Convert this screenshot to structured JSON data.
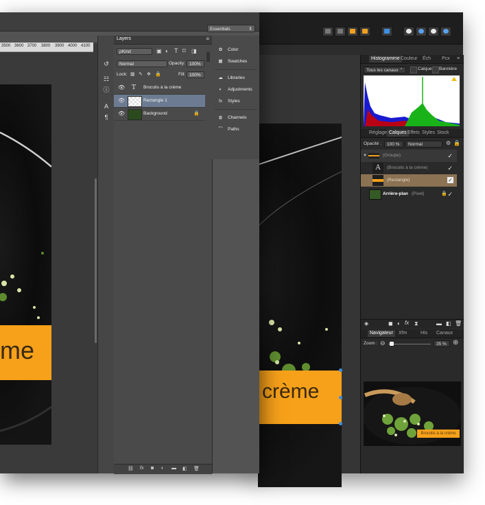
{
  "colors": {
    "accent": "#f7a11a",
    "ps_selected_row": "#6c7b91",
    "aff_selected_row": "#8a7253"
  },
  "photoshop": {
    "workspace_label": "Essentials",
    "ruler_ticks": [
      "3500",
      "3600",
      "3700",
      "3800",
      "3900",
      "4000",
      "4100"
    ],
    "photo_text": "me",
    "tool_icons": [
      "history-icon",
      "properties-icon",
      "info-icon",
      "character-icon",
      "paragraph-icon"
    ],
    "layers_panel": {
      "title": "Layers",
      "filter_label": "ρKind",
      "blend_mode": "Normal",
      "opacity_label": "Opacity:",
      "opacity_value": "100%",
      "lock_label": "Lock:",
      "fill_label": "Fill:",
      "fill_value": "100%",
      "layers": [
        {
          "name": "Brocolis à la crème",
          "kind": "text"
        },
        {
          "name": "Rectangle 1",
          "kind": "shape"
        },
        {
          "name": "Background",
          "kind": "image"
        }
      ]
    },
    "right_panels": [
      {
        "label": "Color",
        "icon": "color-icon"
      },
      {
        "label": "Swatches",
        "icon": "swatches-icon"
      },
      {
        "label": "Libraries",
        "icon": "libraries-icon"
      },
      {
        "label": "Adjustments",
        "icon": "adjustments-icon"
      },
      {
        "label": "Styles",
        "icon": "styles-icon"
      },
      {
        "label": "Channels",
        "icon": "channels-icon"
      },
      {
        "label": "Paths",
        "icon": "paths-icon"
      }
    ]
  },
  "affinity": {
    "histogram_tabs": [
      "Histogramme",
      "Couleur",
      "Éch",
      "Pcx"
    ],
    "channel_select": "Tous les canaux",
    "calque_label": "Calque",
    "banniere_label": "Bannière",
    "layer_tabs": [
      "Réglage",
      "Calques",
      "Effets",
      "Styles",
      "Stock"
    ],
    "opacity_label": "Opacité :",
    "opacity_value": "100 %",
    "blend_mode": "Normal",
    "layers": [
      {
        "name": "(Groupe)"
      },
      {
        "name": "(Brocolis à la crème)"
      },
      {
        "name": "(Rectangle)"
      },
      {
        "name": "Arrière-plan",
        "suffix": "(Pixel)"
      }
    ],
    "nav_tabs": [
      "Navigateur",
      "Xfm",
      "His",
      "Canaux"
    ],
    "zoom_label": "Zoom :",
    "zoom_value": "35 %",
    "photo_text": "crème",
    "preview_label": "Brocolis à la crème"
  }
}
